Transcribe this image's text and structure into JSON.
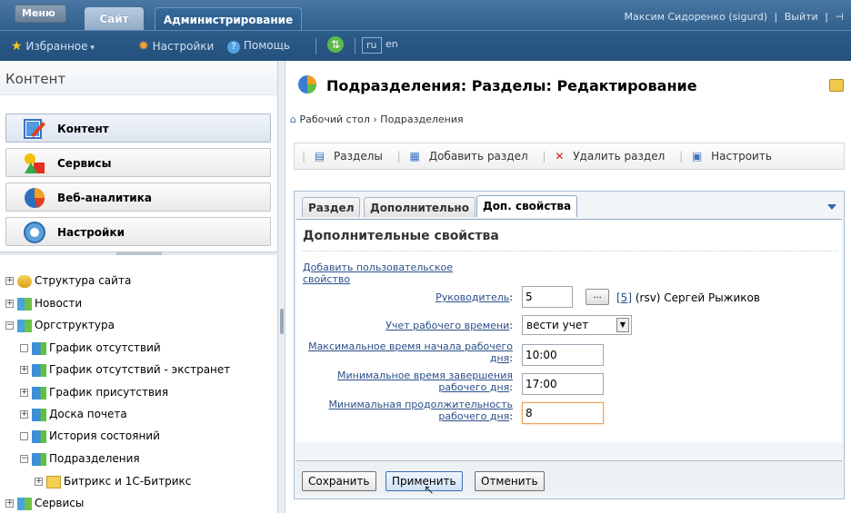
{
  "topbar": {
    "menu_label": "Меню",
    "site_tab": "Сайт",
    "admin_tab": "Администрирование",
    "user_name": "Максим Сидоренко (sigurd)",
    "logout": "Выйти"
  },
  "toolbar2": {
    "favorites": "Избранное",
    "settings": "Настройки",
    "help": "Помощь",
    "lang_ru": "ru",
    "lang_en": "en"
  },
  "left": {
    "header": "Контент",
    "buttons": [
      {
        "label": "Контент"
      },
      {
        "label": "Сервисы"
      },
      {
        "label": "Веб-аналитика"
      },
      {
        "label": "Настройки"
      }
    ],
    "tree": [
      {
        "label": "Структура сайта",
        "sign": "+"
      },
      {
        "label": "Новости",
        "sign": "+"
      },
      {
        "label": "Оргструктура",
        "sign": "−"
      },
      {
        "label": "График отсутствий",
        "sign": ""
      },
      {
        "label": "График отсутствий - экстранет",
        "sign": "+"
      },
      {
        "label": "График присутствия",
        "sign": "+"
      },
      {
        "label": "Доска почета",
        "sign": "+"
      },
      {
        "label": "История состояний",
        "sign": ""
      },
      {
        "label": "Подразделения",
        "sign": "−"
      },
      {
        "label": "Битрикс и 1С-Битрикс",
        "sign": "+"
      },
      {
        "label": "Сервисы",
        "sign": "+"
      }
    ]
  },
  "main": {
    "title": "Подразделения: Разделы: Редактирование",
    "breadcrumb": [
      "Рабочий стол",
      "Подразделения"
    ],
    "breadcrumb_sep": "›",
    "actions": [
      "Разделы",
      "Добавить раздел",
      "Удалить раздел",
      "Настроить"
    ],
    "tabs": [
      "Раздел",
      "Дополнительно",
      "Доп. свойства"
    ],
    "section_title": "Дополнительные свойства",
    "add_property_link": "Добавить пользовательское свойство",
    "fields": {
      "manager_label": "Руководитель",
      "manager_value": "5",
      "manager_btn": "...",
      "manager_id": "[5]",
      "manager_info": "(rsv) Сергей Рыжиков",
      "worktime_label": "Учет рабочего времени",
      "worktime_value": "вести учет",
      "max_start_label": "Максимальное время начала рабочего дня",
      "max_start_value": "10:00",
      "min_end_label": "Минимальное время завершения рабочего дня",
      "min_end_value": "17:00",
      "min_duration_label": "Минимальная продолжительность рабочего дня",
      "min_duration_value": "8"
    },
    "buttons": {
      "save": "Сохранить",
      "apply": "Применить",
      "cancel": "Отменить"
    }
  },
  "colors": {
    "topbar": "#2f5f8c",
    "link": "#2a4f8a",
    "active_border": "#e8a55c"
  }
}
